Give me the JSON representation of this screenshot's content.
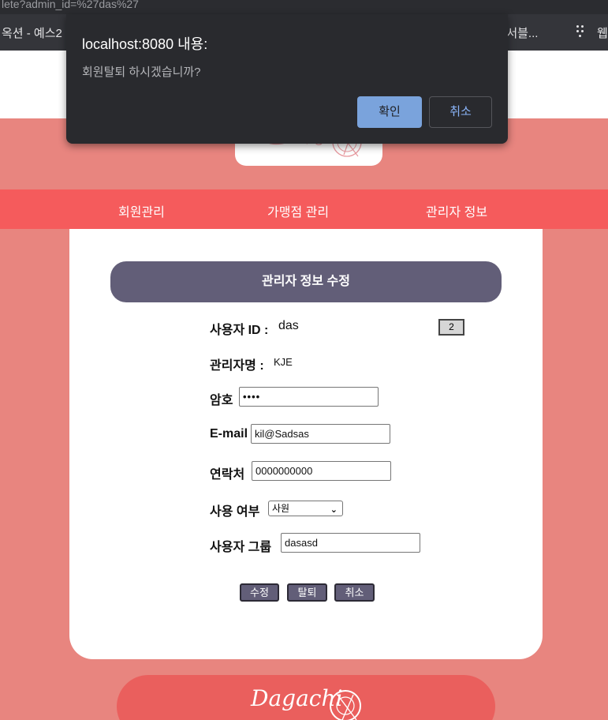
{
  "browser": {
    "url_fragment": "lete?admin_id=%27das%27",
    "bookmark_left": "옥션 - 예스2",
    "bookmark_right": "] 서블...",
    "bookmark_web": "웹"
  },
  "nav": {
    "items": [
      {
        "label": "회원관리"
      },
      {
        "label": "가맹점 관리"
      },
      {
        "label": "관리자 정보"
      }
    ]
  },
  "form": {
    "title": "관리자 정보 수정",
    "user_id_label": "사용자 ID :",
    "user_id_value": "das",
    "badge_value": "2",
    "admin_name_label": "관리자명 :",
    "admin_name_value": "KJE",
    "password_label": "암호",
    "password_value": "••••",
    "email_label": "E-mail",
    "email_value": "kil@Sadsas",
    "phone_label": "연락처",
    "phone_value": "0000000000",
    "usage_label": "사용 여부",
    "usage_selected": "사원",
    "group_label": "사용자 그룹",
    "group_value": "dasasd",
    "buttons": {
      "edit": "수정",
      "withdraw": "탈퇴",
      "cancel": "취소"
    }
  },
  "footer": {
    "logo_text": "Dagachi"
  },
  "dialog": {
    "title": "localhost:8080 내용:",
    "message": "회원탈퇴 하시겠습니까?",
    "ok_label": "확인",
    "cancel_label": "취소"
  },
  "colors": {
    "page_bg": "#e8857f",
    "nav_bg": "#f55b5c",
    "title_bar": "#625e78",
    "dialog_bg": "#292a2e",
    "dialog_ok": "#7aa3dc"
  }
}
